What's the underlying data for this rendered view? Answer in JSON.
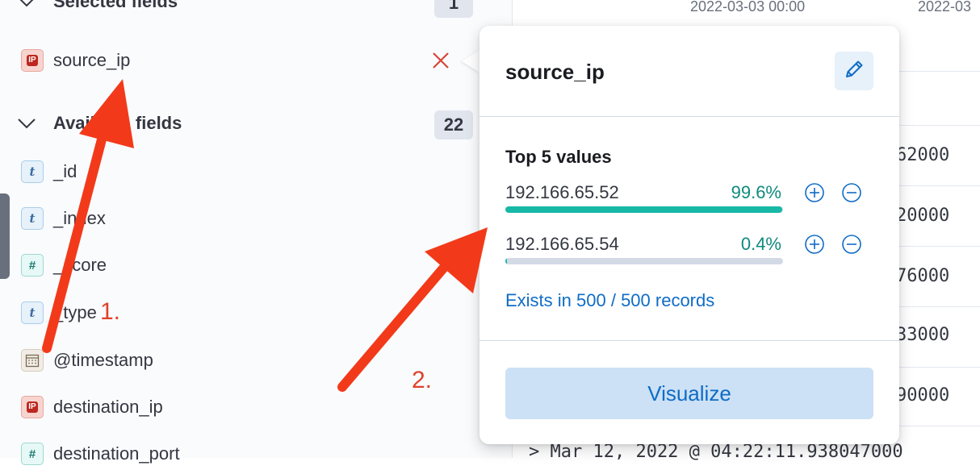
{
  "sidebar": {
    "selected_fields": {
      "title": "Selected fields",
      "count": "1"
    },
    "selected_items": [
      {
        "name": "source_ip",
        "type": "ip",
        "type_label": "IP"
      }
    ],
    "available_fields": {
      "title": "Available fields",
      "count": "22"
    },
    "available_items": [
      {
        "name": "_id",
        "type": "string",
        "type_label": "t"
      },
      {
        "name": "_index",
        "type": "string",
        "type_label": "t"
      },
      {
        "name": "_score",
        "type": "number",
        "type_label": "#"
      },
      {
        "name": "_type",
        "type": "string",
        "type_label": "t"
      },
      {
        "name": "@timestamp",
        "type": "date",
        "type_label": "calendar-icon"
      },
      {
        "name": "destination_ip",
        "type": "ip",
        "type_label": "IP"
      },
      {
        "name": "destination_port",
        "type": "number",
        "type_label": "#"
      }
    ]
  },
  "grid": {
    "header_timestamps": [
      "2022-03-03 00:00",
      "2022-03"
    ],
    "cell_values": [
      "62000",
      "20000",
      "76000",
      "33000",
      "90000"
    ],
    "bottom_row": "> Mar 12, 2022 @ 04:22:11.938047000"
  },
  "popover": {
    "title": "source_ip",
    "top_values_title": "Top 5 values",
    "values": [
      {
        "value": "192.166.65.52",
        "percent_label": "99.6%",
        "percent": 99.6
      },
      {
        "value": "192.166.65.54",
        "percent_label": "0.4%",
        "percent": 0.4
      }
    ],
    "exists_text": "Exists in 500 / 500 records",
    "visualize_label": "Visualize"
  },
  "annotations": {
    "label_1": "1.",
    "label_2": "2.",
    "color": "#f23a1a"
  }
}
